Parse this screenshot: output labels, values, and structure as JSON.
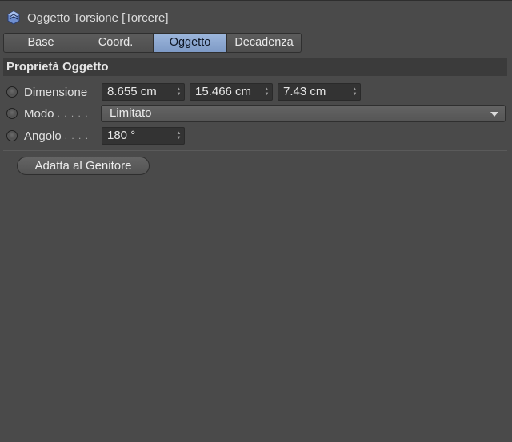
{
  "window": {
    "title": "Oggetto Torsione [Torcere]",
    "icon": "twist-deformer-icon"
  },
  "tabs": [
    {
      "label": "Base",
      "active": false
    },
    {
      "label": "Coord.",
      "active": false
    },
    {
      "label": "Oggetto",
      "active": true
    },
    {
      "label": "Decadenza",
      "active": false
    }
  ],
  "section": {
    "title": "Proprietà Oggetto"
  },
  "properties": {
    "dimensione": {
      "label": "Dimensione",
      "x": "8.655 cm",
      "y": "15.466 cm",
      "z": "7.43 cm"
    },
    "modo": {
      "label": "Modo",
      "dots": ". . . . .",
      "value": "Limitato"
    },
    "angolo": {
      "label": "Angolo",
      "dots": ". . . .",
      "value": "180 °"
    }
  },
  "actions": {
    "fit_to_parent": "Adatta al Genitore"
  },
  "colors": {
    "background": "#4a4a4a",
    "active_tab": "#8ea8d2",
    "section_header": "#3b3b3b"
  }
}
